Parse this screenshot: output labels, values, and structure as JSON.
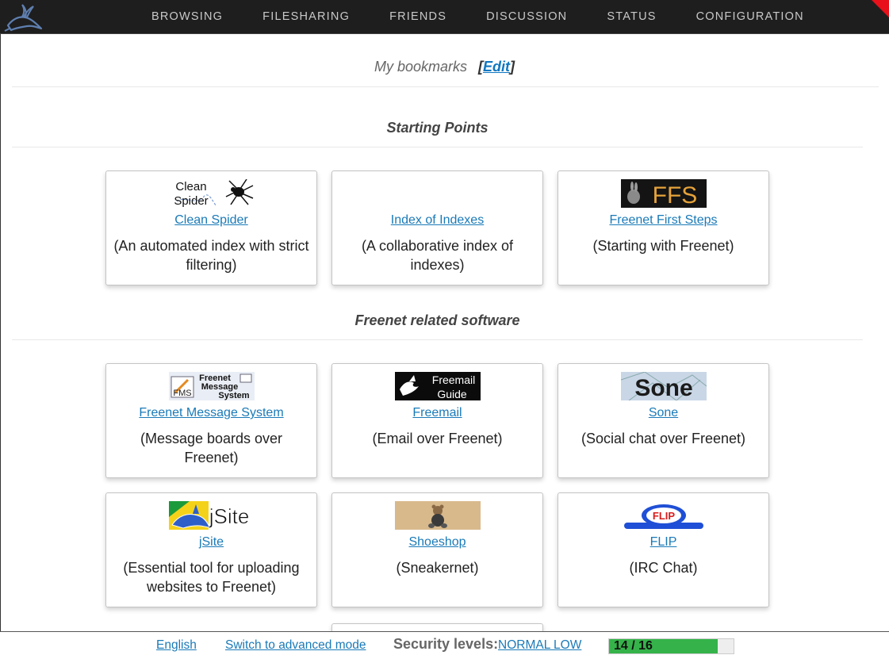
{
  "nav": {
    "items": [
      "BROWSING",
      "FILESHARING",
      "FRIENDS",
      "DISCUSSION",
      "STATUS",
      "CONFIGURATION"
    ]
  },
  "bookmarks": {
    "title": "My bookmarks",
    "edit_open": "[",
    "edit_label": "Edit",
    "edit_close": "]"
  },
  "sections": [
    {
      "title": "Starting Points",
      "cards": [
        {
          "icon": "clean-spider-icon",
          "icon_text_1": "Clean",
          "icon_text_2": "Spider",
          "link": "Clean Spider",
          "desc": "(An automated index with strict filtering)"
        },
        {
          "icon": "none",
          "link": "Index of Indexes",
          "desc": "(A collaborative index of indexes)"
        },
        {
          "icon": "ffs-icon",
          "icon_text": "FFS",
          "link": "Freenet First Steps",
          "desc": "(Starting with Freenet)"
        }
      ]
    },
    {
      "title": "Freenet related software",
      "cards": [
        {
          "icon": "fms-icon",
          "icon_text_1": "Freenet",
          "icon_text_2": "Message",
          "icon_text_3": "System",
          "icon_text_4": "FMS",
          "link": "Freenet Message System",
          "desc": "(Message boards over Freenet)"
        },
        {
          "icon": "freemail-icon",
          "icon_text_1": "Freemail",
          "icon_text_2": "Guide",
          "link": "Freemail",
          "desc": "(Email over Freenet)"
        },
        {
          "icon": "sone-icon",
          "icon_text": "Sone",
          "link": "Sone",
          "desc": "(Social chat over Freenet)"
        },
        {
          "icon": "jsite-icon",
          "icon_text": "jSite",
          "link": "jSite",
          "desc": "(Essential tool for uploading websites to Freenet)"
        },
        {
          "icon": "shoeshop-icon",
          "link": "Shoeshop",
          "desc": "(Sneakernet)"
        },
        {
          "icon": "flip-icon",
          "icon_text": "FLIP",
          "link": "FLIP",
          "desc": "(IRC Chat)"
        }
      ]
    }
  ],
  "footer": {
    "language": "English",
    "mode_switch": "Switch to advanced mode",
    "security_label": "Security levels:",
    "security_levels": "NORMAL LOW",
    "peers_text": "14 / 16",
    "peers_connected": 14,
    "peers_total": 16
  },
  "colors": {
    "topbar": "#1e1e1e",
    "link": "#1a7ab8",
    "corner_alert": "#e8101a",
    "peer_bar": "#35b34a"
  }
}
